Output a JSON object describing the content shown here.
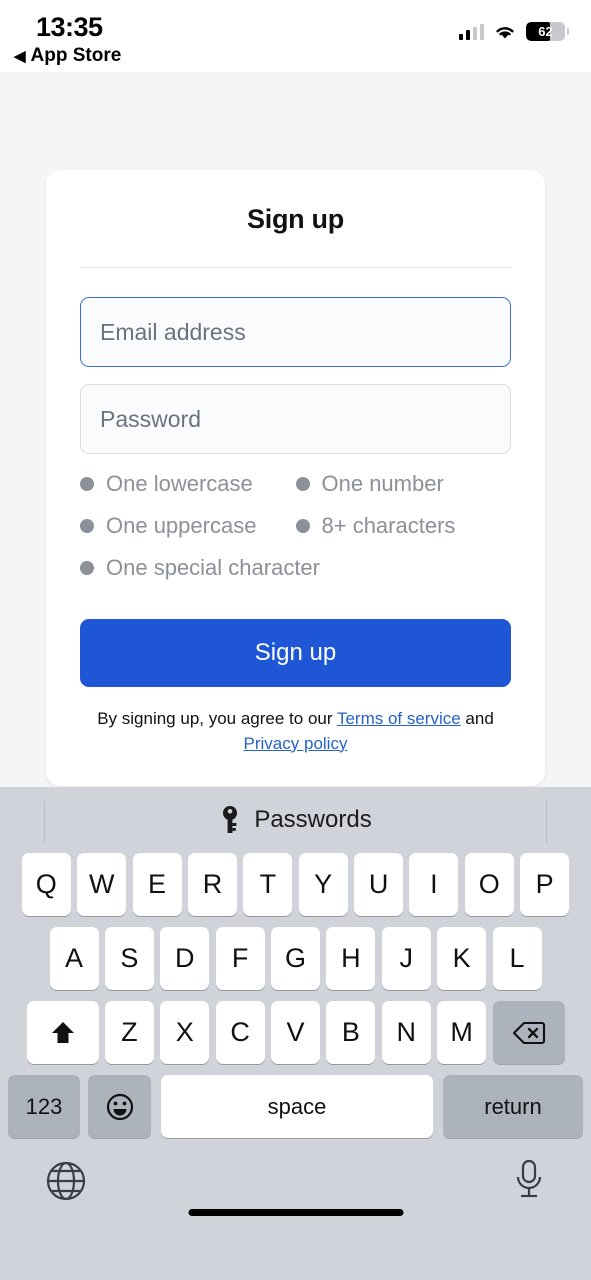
{
  "status_bar": {
    "time": "13:35",
    "back_label": "App Store",
    "back_caret": "◀",
    "battery_percent": "62",
    "battery_level": 62,
    "icons": [
      "signal-bars-icon",
      "wifi-icon",
      "battery-icon"
    ]
  },
  "card": {
    "title": "Sign up",
    "email_field": {
      "placeholder": "Email address",
      "value": "",
      "focused": true
    },
    "password_field": {
      "placeholder": "Password",
      "value": "",
      "focused": false
    },
    "requirements": [
      {
        "label": "One lowercase",
        "met": false
      },
      {
        "label": "One number",
        "met": false
      },
      {
        "label": "One uppercase",
        "met": false
      },
      {
        "label": "8+ characters",
        "met": false
      },
      {
        "label": "One special character",
        "met": false
      }
    ],
    "submit_label": "Sign up",
    "legal": {
      "prefix": "By signing up, you agree to our ",
      "terms_link": "Terms of service",
      "middle": " and ",
      "privacy_link": "Privacy policy"
    }
  },
  "keyboard": {
    "toolbar": {
      "icon": "key-icon",
      "label": "Passwords"
    },
    "row1": [
      "Q",
      "W",
      "E",
      "R",
      "T",
      "Y",
      "U",
      "I",
      "O",
      "P"
    ],
    "row2": [
      "A",
      "S",
      "D",
      "F",
      "G",
      "H",
      "J",
      "K",
      "L"
    ],
    "row3": [
      "Z",
      "X",
      "C",
      "V",
      "B",
      "N",
      "M"
    ],
    "shift_icon": "shift-up-arrow-icon",
    "backspace_icon": "backspace-delete-icon",
    "numbers_label": "123",
    "emoji_icon": "emoji-smiley-icon",
    "space_label": "space",
    "return_label": "return",
    "globe_icon": "globe-language-icon",
    "mic_icon": "microphone-dictation-icon"
  },
  "colors": {
    "accent_blue": "#1e56d6",
    "link_blue": "#2563c9",
    "focus_border": "#3b6fd4",
    "page_bg": "#f4f5f6",
    "keyboard_bg": "#d0d3da",
    "key_gray": "#adb3bd",
    "muted_text": "#8b9099"
  }
}
